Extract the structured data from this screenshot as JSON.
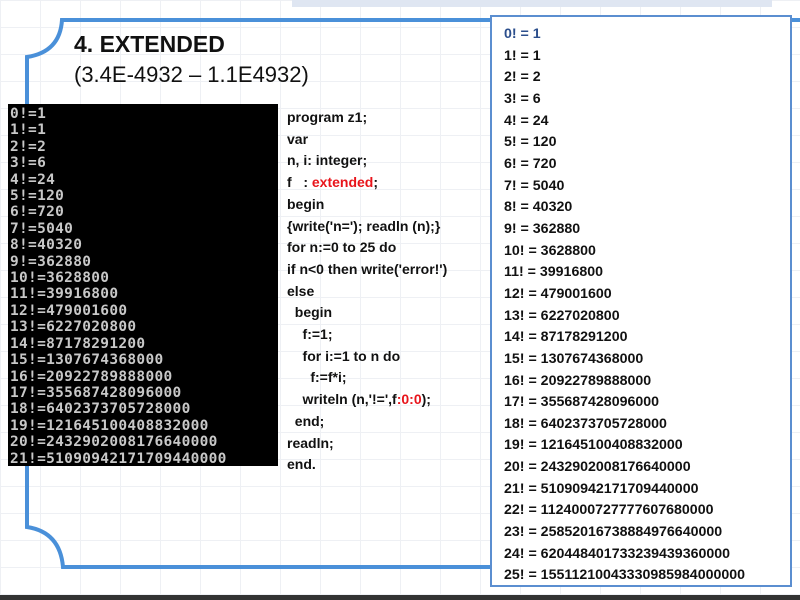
{
  "slide": {
    "title": "4. EXTENDED",
    "subtitle": "(3.4E-4932 – 1.1E4932)"
  },
  "terminal_output": [
    "0!=1",
    "1!=1",
    "2!=2",
    "3!=6",
    "4!=24",
    "5!=120",
    "6!=720",
    "7!=5040",
    "8!=40320",
    "9!=362880",
    "10!=3628800",
    "11!=39916800",
    "12!=479001600",
    "13!=6227020800",
    "14!=87178291200",
    "15!=1307674368000",
    "16!=20922789888000",
    "17!=355687428096000",
    "18!=6402373705728000",
    "19!=121645100408832000",
    "20!=2432902008176640000",
    "21!=51090942171709440000"
  ],
  "code": {
    "l1": "program z1;",
    "l2": "var",
    "l3": "n, i: integer;",
    "l4a": "f   : ",
    "l4b": "extended",
    "l4c": ";",
    "l5": "begin",
    "l6": "{write('n='); readln (n);}",
    "l7": "for n:=0 to 25 do",
    "l8": "if n<0 then write('error!')",
    "l9": "else",
    "l10": "  begin",
    "l11": "    f:=1;",
    "l12": "    for i:=1 to n do",
    "l13": "      f:=f*i;",
    "l14a": "    writeln (n,'!=',f",
    "l14b": ":0:0",
    "l14c": ");",
    "l15": "  end;",
    "l16": "readln;",
    "l17": "end."
  },
  "results": [
    "0! = 1",
    "1! = 1",
    "2! = 2",
    "3! = 6",
    "4! = 24",
    "5! = 120",
    "6! = 720",
    "7! = 5040",
    "8! = 40320",
    "9! = 362880",
    "10! = 3628800",
    "11! = 39916800",
    "12! = 479001600",
    "13! = 6227020800",
    "14! = 87178291200",
    "15! = 1307674368000",
    "16! = 20922789888000",
    "17! = 355687428096000",
    "18! = 6402373705728000",
    "19! = 121645100408832000",
    "20! = 2432902008176640000",
    "21! = 51090942171709440000",
    "22! = 1124000727777607680000",
    "23! = 25852016738884976640000",
    "24! = 620448401733239439360000",
    "25! = 15511210043330985984000000"
  ],
  "colors": {
    "frame": "#4a90d9",
    "highlight": "#e8141b"
  }
}
